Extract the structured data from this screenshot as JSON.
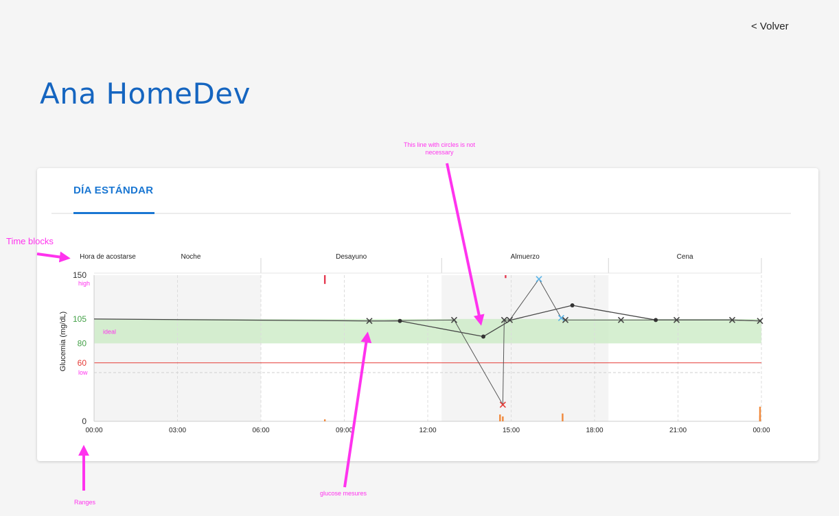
{
  "header": {
    "back_label": "< Volver"
  },
  "patient": {
    "name": "Ana HomeDev"
  },
  "tabs": [
    {
      "label": "DÍA ESTÁNDAR",
      "active": true
    }
  ],
  "annotations": {
    "time_blocks": "Time blocks",
    "line_note": "This line with circles is not necessary",
    "glucose": "glucose mesures",
    "ranges": "Ranges"
  },
  "colors": {
    "accent": "#1976d2",
    "title": "#1565c0",
    "ideal_band": "#ccebc5",
    "low_line": "#e53935",
    "annotation": "#ff33ee",
    "point_normal": "#444444",
    "point_low": "#e53935",
    "point_high": "#5ab4e8",
    "insulin": "#e53950",
    "carbs": "#f0883a"
  },
  "chart_data": {
    "type": "line",
    "ylabel": "Glucemia (mg/dL)",
    "xlabel": "",
    "xlim": [
      0,
      24
    ],
    "ylim": [
      0,
      150
    ],
    "x_ticks": [
      {
        "value": 0,
        "label": "00:00"
      },
      {
        "value": 3,
        "label": "03:00"
      },
      {
        "value": 6,
        "label": "06:00"
      },
      {
        "value": 9,
        "label": "09:00"
      },
      {
        "value": 12,
        "label": "12:00"
      },
      {
        "value": 15,
        "label": "15:00"
      },
      {
        "value": 18,
        "label": "18:00"
      },
      {
        "value": 21,
        "label": "21:00"
      },
      {
        "value": 24,
        "label": "00:00"
      }
    ],
    "y_ticks": [
      {
        "value": 0,
        "label": "0",
        "color": "#333333"
      },
      {
        "value": 60,
        "label": "60",
        "color": "#e53935"
      },
      {
        "value": 80,
        "label": "80",
        "color": "#43a047"
      },
      {
        "value": 105,
        "label": "105",
        "color": "#43a047"
      },
      {
        "value": 150,
        "label": "150",
        "color": "#333333"
      }
    ],
    "range_labels": [
      {
        "label": "high",
        "value": 150
      },
      {
        "label": "ideal",
        "value": 92
      },
      {
        "label": "low",
        "value": 50
      }
    ],
    "ideal_range": [
      80,
      105
    ],
    "low_threshold": 60,
    "low_dashed": 50,
    "time_blocks": [
      {
        "label": "Hora de acostarse",
        "start": 0,
        "end": 0,
        "shaded": true
      },
      {
        "label": "Noche",
        "start": 0,
        "end": 6,
        "shaded": true
      },
      {
        "label": "Desayuno",
        "start": 6,
        "end": 12.5,
        "shaded": false
      },
      {
        "label": "Almuerzo",
        "start": 12.5,
        "end": 18.5,
        "shaded": true
      },
      {
        "label": "Cena",
        "start": 18.5,
        "end": 24,
        "shaded": false
      }
    ],
    "series": [
      {
        "kind": "measurements",
        "points": [
          {
            "x": 9.9,
            "y": 103,
            "status": "normal"
          },
          {
            "x": 12.95,
            "y": 104,
            "status": "normal"
          },
          {
            "x": 14.7,
            "y": 17,
            "status": "low"
          },
          {
            "x": 14.75,
            "y": 104,
            "status": "normal"
          },
          {
            "x": 14.95,
            "y": 104,
            "status": "normal"
          },
          {
            "x": 16.0,
            "y": 146,
            "status": "high"
          },
          {
            "x": 16.8,
            "y": 106,
            "status": "high"
          },
          {
            "x": 16.95,
            "y": 104,
            "status": "normal"
          },
          {
            "x": 18.95,
            "y": 104,
            "status": "normal"
          },
          {
            "x": 20.95,
            "y": 104,
            "status": "normal"
          },
          {
            "x": 22.95,
            "y": 104,
            "status": "normal"
          },
          {
            "x": 23.95,
            "y": 103,
            "status": "normal"
          }
        ]
      },
      {
        "kind": "average-line",
        "points": [
          {
            "x": 0,
            "y": 105
          },
          {
            "x": 9.9,
            "y": 103
          },
          {
            "x": 11.0,
            "y": 103
          },
          {
            "x": 14.0,
            "y": 87
          },
          {
            "x": 15.0,
            "y": 104
          },
          {
            "x": 17.2,
            "y": 119
          },
          {
            "x": 20.2,
            "y": 104
          },
          {
            "x": 22.9,
            "y": 104
          },
          {
            "x": 24,
            "y": 103
          }
        ],
        "circles_at": [
          11.0,
          14.0,
          17.2,
          20.2
        ]
      }
    ],
    "insulin_marks": [
      {
        "x": 8.3,
        "y_top": 150,
        "y_bottom": 141
      },
      {
        "x": 14.8,
        "y_top": 150,
        "y_bottom": 147
      }
    ],
    "carb_marks": [
      {
        "x": 8.3,
        "height": 2
      },
      {
        "x": 14.6,
        "height": 7
      },
      {
        "x": 14.7,
        "height": 5
      },
      {
        "x": 16.85,
        "height": 8
      },
      {
        "x": 23.95,
        "height": 15
      },
      {
        "x": 23.95,
        "height": 6
      }
    ]
  }
}
